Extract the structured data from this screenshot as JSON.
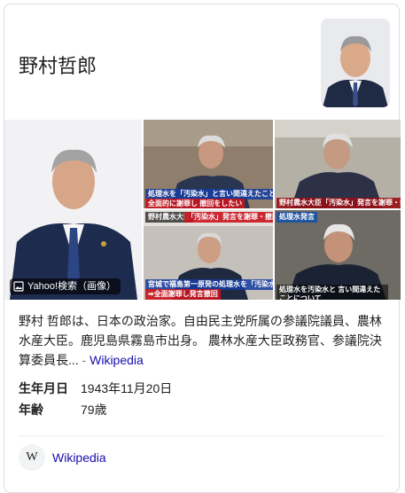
{
  "title": "野村哲郎",
  "images_badge": "Yahoo!検索（画像）",
  "captions": {
    "c1": "処理水を「汚染水」と言い間違えたことについて",
    "c2": "全面的に謝罪し 撤回をしたい",
    "c3": "野村農水大臣「汚染水」発言を謝罪・撤回",
    "c4": "野村農水大臣",
    "c5": "「汚染水」発言を謝罪・撤回",
    "c6": "宮城で福島第一原発の処理水を「汚染水」と発言",
    "c7": "➡全面謝罪し発言撤回",
    "c8": "処理水発言",
    "c9": "処理水を汚染水と 言い間違えたことについて"
  },
  "description": {
    "text": "野村 哲郎は、日本の政治家。自由民主党所属の参議院議員、農林水産大臣。鹿児島県霧島市出身。 農林水産大臣政務官、参議院決算委員長...",
    "dash": " - ",
    "source_link": "Wikipedia"
  },
  "facts": [
    {
      "label": "生年月日",
      "value": "1943年11月20日"
    },
    {
      "label": "年齢",
      "value": "79歳"
    }
  ],
  "profile": {
    "icon_letter": "W",
    "name": "Wikipedia"
  },
  "colors": {
    "link": "#1a0dab",
    "border": "#dadce0",
    "caption_blue": "#143ca0",
    "caption_red": "#c8141e"
  }
}
